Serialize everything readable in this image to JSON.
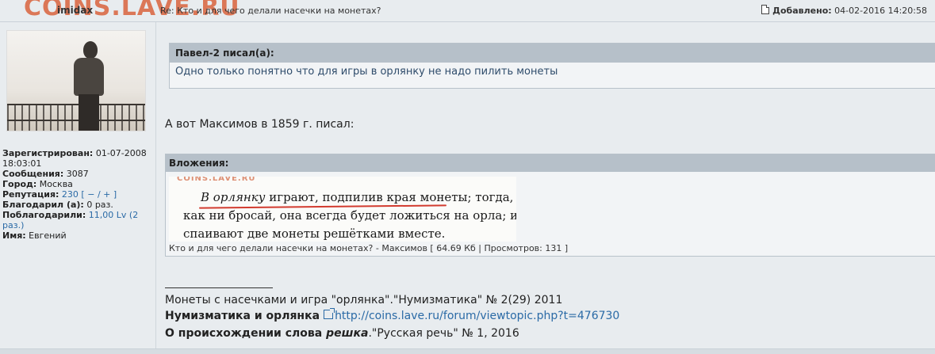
{
  "site": {
    "watermark": "COINS.LAVE.RU"
  },
  "post": {
    "author": "imidax",
    "title": "Re: Кто и для чего делали насечки на монетах?",
    "date_label": "Добавлено:",
    "date_value": "04-02-2016 14:20:58"
  },
  "profile": {
    "registered_label": "Зарегистрирован:",
    "registered_value": "01-07-2008 18:03:01",
    "messages_label": "Сообщения:",
    "messages_value": "3087",
    "city_label": "Город:",
    "city_value": "Москва",
    "reputation_label": "Репутация:",
    "reputation_value": "230",
    "reputation_controls_open": "[",
    "reputation_minus": "−",
    "reputation_sep": "/",
    "reputation_plus": "+",
    "reputation_controls_close": "]",
    "thanked_label": "Благодарил (а):",
    "thanked_value": "0 раз.",
    "was_thanked_label": "Поблагодарили:",
    "was_thanked_value": "11,00 Lv",
    "was_thanked_count": "(2 раз.)",
    "name_label": "Имя:",
    "name_value": "Евгений"
  },
  "quote": {
    "header": "Павел-2 писал(а):",
    "text": "Одно только понятно что для игры в орлянку не надо пилить монеты"
  },
  "body_text": "А вот Максимов в 1859 г. писал:",
  "attachment": {
    "header": "Вложения:",
    "scan_watermark": "COINS.LAVE.RU",
    "scan_line1_italic": "В орлянку",
    "scan_line1_rest": " играют, подпилив края монеты; тогда,",
    "scan_line2": "как ни бросай, она всегда будет ложиться на орла; или",
    "scan_line3": "спаивают две монеты решётками вместе.",
    "caption": "Кто и для чего делали насечки на монетах? - Максимов [ 64.69 Кб | Просмотров: 131 ]"
  },
  "signature": {
    "line1": "Монеты с насечками и игра \"орлянка\".\"Нумизматика\" № 2(29) 2011",
    "line2_bold": "Нумизматика и орлянка",
    "line2_link": "http://coins.lave.ru/forum/viewtopic.php?t=476730",
    "line3_bold": "О происхождении слова ",
    "line3_bold_italic": "решка",
    "line3_rest": ".\"Русская речь\" № 1, 2016"
  }
}
